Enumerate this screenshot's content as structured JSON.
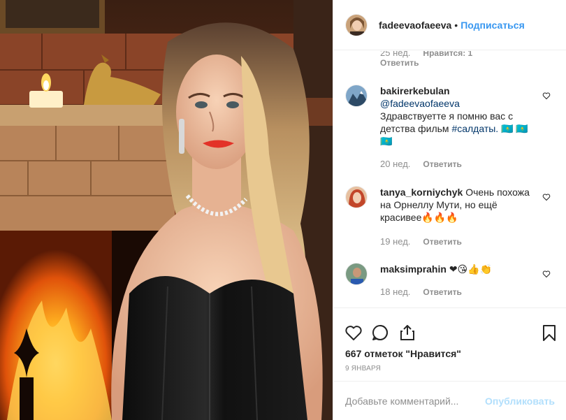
{
  "post": {
    "image_alt": "portrait photo",
    "header": {
      "username": "fadeevaofaeeva",
      "separator": "•",
      "follow_label": "Подписаться"
    },
    "top_meta": {
      "time": "25 нед.",
      "likes": "Нравится: 1",
      "reply": "Ответить"
    },
    "comments": [
      {
        "user": "bakirerkebulan",
        "mention": "@fadeevaofaeeva",
        "text": "Здравствуетте я помню вас с детства фильм",
        "hashtag": "#салдаты.",
        "emoji": "🇰🇿 🇰🇿 🇰🇿",
        "time": "20 нед.",
        "reply": "Ответить"
      },
      {
        "user": "tanya_korniychyk",
        "text": "Очень похожа на Орнеллу Мути, но ещё красивее🔥🔥🔥",
        "time": "19 нед.",
        "reply": "Ответить"
      },
      {
        "user": "maksimprahin",
        "text": "❤😘👍👏",
        "time": "18 нед.",
        "reply": "Ответить"
      }
    ],
    "likes_text": "667 отметок \"Нравится\"",
    "date": "9 января",
    "add_comment": {
      "placeholder": "Добавьте комментарий...",
      "publish_label": "Опубликовать"
    }
  },
  "colors": {
    "accent": "#3897f0",
    "link": "#003569",
    "muted": "#8e8e8e",
    "publish_disabled": "#b2dffc"
  },
  "icons": [
    "heart-icon",
    "comment-icon",
    "share-icon",
    "bookmark-icon"
  ]
}
